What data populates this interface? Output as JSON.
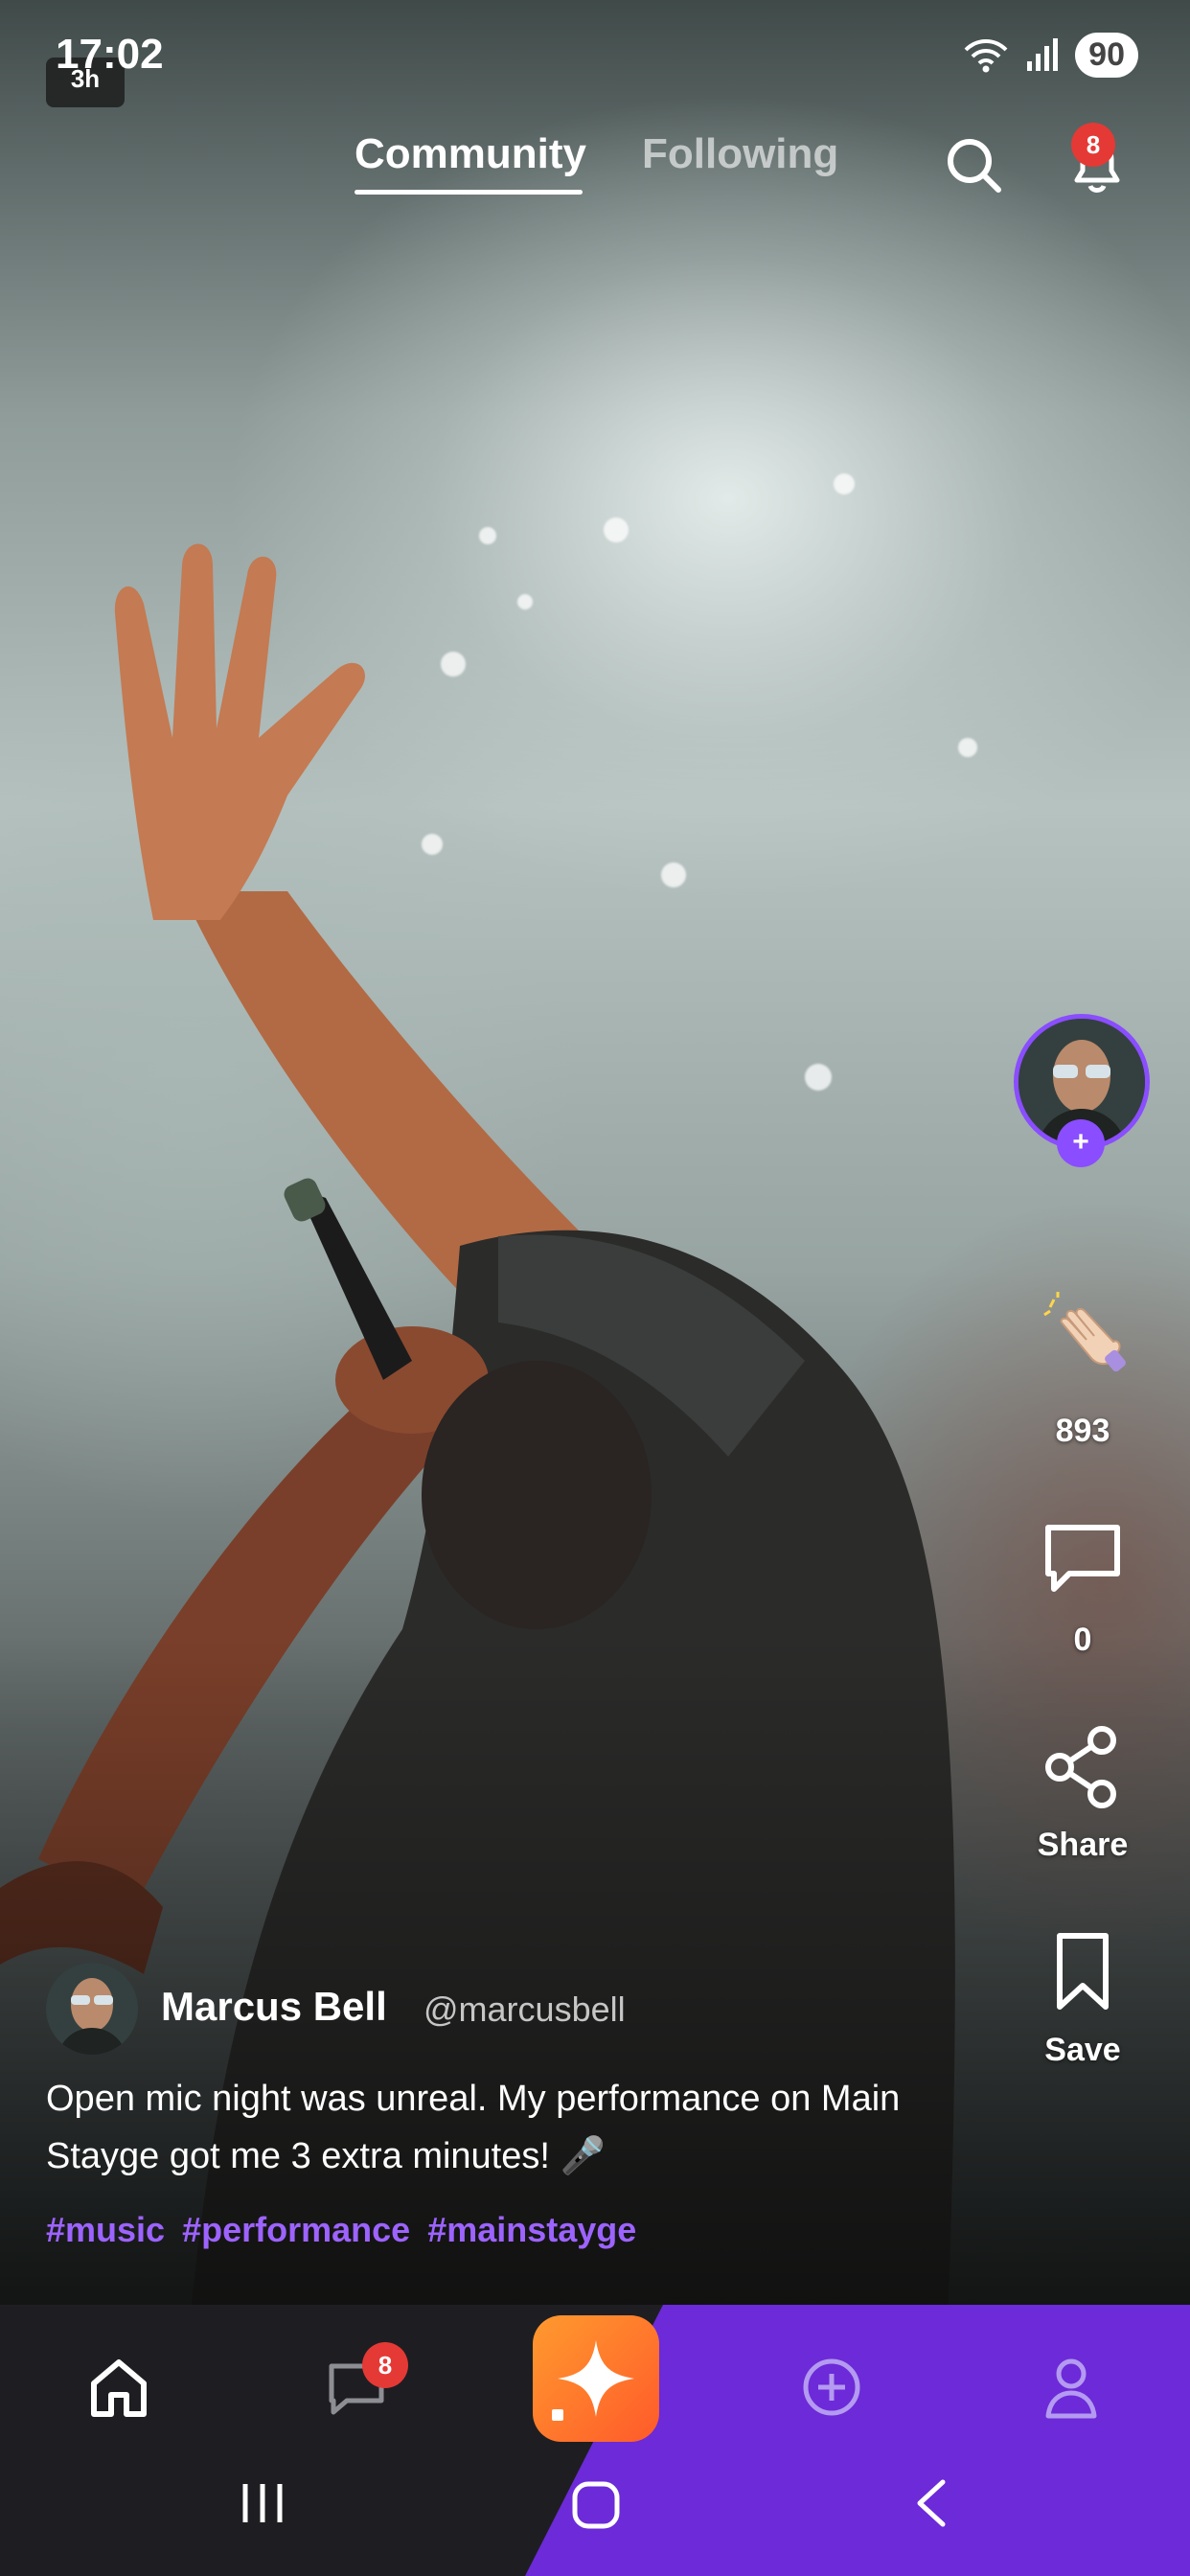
{
  "status_bar": {
    "time": "17:02",
    "chip": "3h",
    "battery": "90"
  },
  "header": {
    "tabs": [
      {
        "label": "Community",
        "active": true
      },
      {
        "label": "Following",
        "active": false
      }
    ],
    "notification_count": "8"
  },
  "actions": {
    "claps_count": "893",
    "comments_count": "0",
    "share_label": "Share",
    "save_label": "Save"
  },
  "post": {
    "author_name": "Marcus Bell",
    "author_handle": "@marcusbell",
    "caption": "Open mic night was unreal. My performance on Main Stayge got me 3 extra minutes! 🎤",
    "tags": [
      "#music",
      "#performance",
      "#mainstayge"
    ]
  },
  "bottom_nav": {
    "items": [
      "home-icon",
      "chat-icon",
      "sparkle-icon",
      "add-circle-icon",
      "profile-icon"
    ],
    "chat_badge": "8"
  },
  "colors": {
    "accent_purple": "#8a4dff",
    "nav_purple": "#6c2ad8",
    "badge_red": "#e53935",
    "center_button_orange": "#ff7a2a"
  }
}
